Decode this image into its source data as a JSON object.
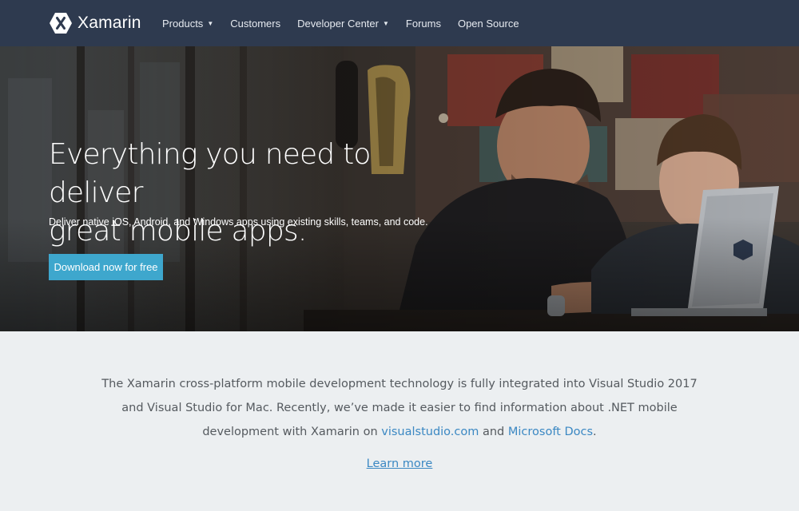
{
  "nav": {
    "brand": "Xamarin",
    "logo_icon": "xamarin-hexagon-logo",
    "items": [
      {
        "label": "Products",
        "dropdown": true
      },
      {
        "label": "Customers",
        "dropdown": false
      },
      {
        "label": "Developer Center",
        "dropdown": true
      },
      {
        "label": "Forums",
        "dropdown": false
      },
      {
        "label": "Open Source",
        "dropdown": false
      }
    ]
  },
  "hero": {
    "title_line1": "Everything you need to deliver",
    "title_line2": "great mobile apps.",
    "subtitle": "Deliver native iOS, Android, and Windows apps using existing skills, teams, and code.",
    "cta_label": "Download now for free"
  },
  "info": {
    "text_before": "The Xamarin cross-platform mobile development technology is fully integrated into Visual Studio 2017 and Visual Studio for Mac. Recently, we’ve made it easier to find information about .NET mobile development with Xamarin on ",
    "link1": "visualstudio.com",
    "text_mid": " and ",
    "link2": "Microsoft Docs",
    "text_after": ".",
    "learn_more": "Learn more"
  },
  "colors": {
    "nav_bg": "#2e3a4f",
    "cta_bg": "#3ea7cd",
    "link": "#3b88c3",
    "section_bg": "#eceff1"
  }
}
